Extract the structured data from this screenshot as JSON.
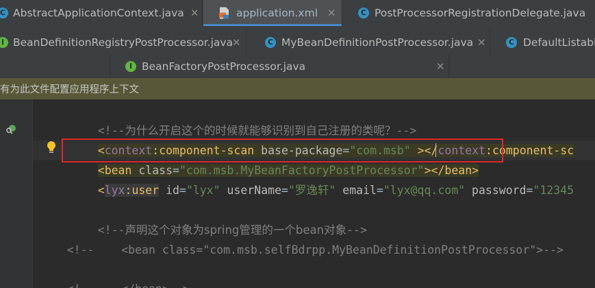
{
  "tabs": {
    "row1": [
      {
        "label": "AbstractApplicationContext.java",
        "icon": "class-icon",
        "active": false
      },
      {
        "label": "application.xml",
        "icon": "xml-file-icon",
        "active": true
      },
      {
        "label": "PostProcessorRegistrationDelegate.java",
        "icon": "class-icon",
        "active": false
      }
    ],
    "row2": [
      {
        "label": "BeanDefinitionRegistryPostProcessor.java",
        "icon": "interface-icon"
      },
      {
        "label": "MyBeanDefinitionPostProcessor.java",
        "icon": "class-icon"
      },
      {
        "label": "DefaultListable",
        "icon": "class-icon"
      }
    ],
    "row3": [
      {
        "label": "BeanFactoryPostProcessor.java",
        "icon": "interface-icon"
      }
    ],
    "close_glyph": "✕"
  },
  "notice": {
    "text": "有为此文件配置应用程序上下文"
  },
  "code": {
    "l1_open": "<!--",
    "l1_text": "为什么开启这个的时候就能够识别到自己注册的类呢？",
    "l1_close": "-->",
    "l2_lt": "<",
    "l2_ns": "context",
    "l2_colon": ":",
    "l2_tag": "component-scan",
    "l2_attr": " base-package",
    "l2_eq": "=",
    "l2_val": "\"com.msb\"",
    "l2_sp": " ",
    "l2_gt": "></",
    "l2_ns2": "context",
    "l2_colon2": ":",
    "l2_tag2": "component-sc",
    "l3_lt": "<",
    "l3_tag": "bean",
    "l3_attr": " class",
    "l3_eq": "=",
    "l3_val": "\"com.msb.MyBeanFactoryPostProcessor\"",
    "l3_gt": "></",
    "l3_tag2": "bean",
    "l3_end": ">",
    "l4_lt": "<",
    "l4_ns": "lyx",
    "l4_colon": ":",
    "l4_tag": "user",
    "l4_a1": " id",
    "l4_eq1": "=",
    "l4_v1": "\"lyx\"",
    "l4_a2": " userName",
    "l4_eq2": "=",
    "l4_v2": "\"罗逸轩\"",
    "l4_a3": " email",
    "l4_eq3": "=",
    "l4_v3": "\"lyx@qq.com\"",
    "l4_a4": " password",
    "l4_eq4": "=",
    "l4_v4": "\"12345",
    "l6_open": "<!--",
    "l6_text": "声明这个对象为spring管理的一个bean对象",
    "l6_close": "-->",
    "l7": "<!--    <bean class=\"com.msb.selfBdrpp.MyBeanDefinitionPostProcessor\">-->",
    "l9": "<!--    </bean>-->"
  },
  "colors": {
    "highlight_box": "#e0282e",
    "active_tab_underline": "#4a88c7",
    "notice_bg": "#585737"
  }
}
